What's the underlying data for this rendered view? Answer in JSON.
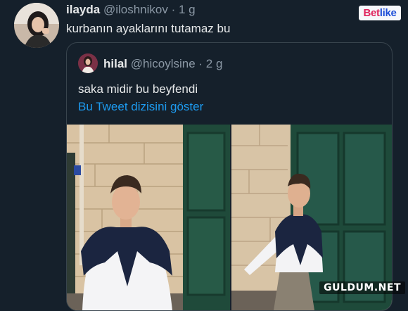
{
  "tweet": {
    "name": "ilayda",
    "handle": "@iloshnikov",
    "time": "· 1 g",
    "text": "kurbanın ayaklarını tutamaz bu"
  },
  "quoted": {
    "name": "hilal",
    "handle": "@hicoylsine",
    "time": "· 2 g",
    "text": "saka midir bu beyfendi",
    "thread_link": "Bu Tweet dizisini göster"
  },
  "watermarks": {
    "top_part1": "Bet",
    "top_part2": "like",
    "bottom": "GULDUM.NET"
  },
  "colors": {
    "background": "#15202b",
    "link": "#1d9bf0",
    "muted": "#8b98a5"
  }
}
